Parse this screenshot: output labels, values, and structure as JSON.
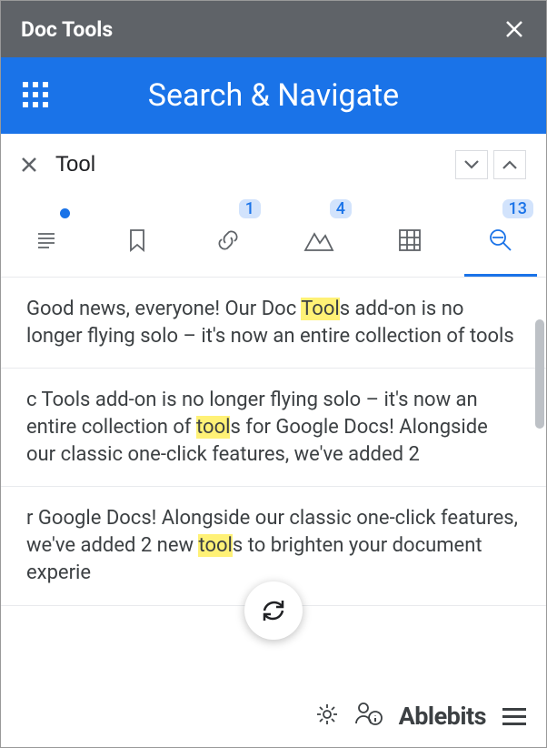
{
  "titlebar": {
    "title": "Doc Tools"
  },
  "banner": {
    "title": "Search & Navigate"
  },
  "search": {
    "value": "Tool"
  },
  "tabs": {
    "text_count": null,
    "bookmark_count": null,
    "link_count": "1",
    "image_count": "4",
    "table_count": null,
    "search_count": "13"
  },
  "results": [
    {
      "pre": "Good news, everyone! Our Doc ",
      "hl": "Tool",
      "post": "s add-on is no longer flying solo – it's now an entire collection of tools"
    },
    {
      "pre": "c Tools add-on is no longer flying solo – it's now an entire collection of ",
      "hl": "tool",
      "post": "s for Google Docs! Alongside our classic one-click features, we've added 2"
    },
    {
      "pre": "r Google Docs! Alongside our classic one-click features, we've added 2 new ",
      "hl": "tool",
      "post": "s to brighten your document experie"
    }
  ],
  "footer": {
    "brand": "Ablebits"
  }
}
